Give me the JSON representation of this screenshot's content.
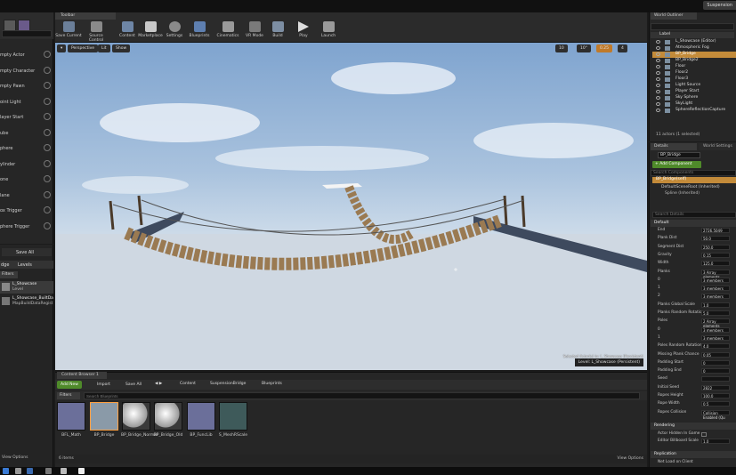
{
  "window": {
    "title": "Suspension"
  },
  "modes": {
    "items": [
      {
        "label": "mpty Actor"
      },
      {
        "label": "mpty Character"
      },
      {
        "label": "mpty Pawn"
      },
      {
        "label": "oint Light"
      },
      {
        "label": "layer Start"
      },
      {
        "label": "ube"
      },
      {
        "label": "phere"
      },
      {
        "label": "ylinder"
      },
      {
        "label": "one"
      },
      {
        "label": "lane"
      },
      {
        "label": "ox Trigger"
      },
      {
        "label": "phere Trigger"
      }
    ]
  },
  "left_panel": {
    "save_all": "Save All",
    "tabs": [
      "dge",
      "Levels"
    ],
    "filters": "Filters",
    "levels": [
      {
        "name": "L_Showcase",
        "sub": "Level"
      },
      {
        "name": "L_Showcase_BuiltDa",
        "sub": "MapBuildDataRegist"
      }
    ]
  },
  "toolbar": {
    "tab": "Toolbar",
    "buttons": [
      {
        "label": "Save Current"
      },
      {
        "label": "Source Control"
      },
      {
        "label": "Content"
      },
      {
        "label": "Marketplace"
      },
      {
        "label": "Settings"
      },
      {
        "label": "Blueprints"
      },
      {
        "label": "Cinematics"
      },
      {
        "label": "VR Mode"
      },
      {
        "label": "Build"
      },
      {
        "label": "Play"
      },
      {
        "label": "Launch"
      }
    ]
  },
  "viewport": {
    "perspective": "Perspective",
    "lit": "Lit",
    "show": "Show",
    "grid_snap": "10",
    "rot_snap": "10°",
    "scale_snap": "0.25",
    "cam_speed": "4",
    "selected_label": "Selected Actor(s) in: L_Showcase (Persistent)",
    "level_label": "Level: L_Showcase (Persistent)"
  },
  "content_browser": {
    "tab": "Content Browser 1",
    "add_new": "Add New",
    "import": "Import",
    "save_all": "Save All",
    "breadcrumb": [
      "Content",
      "SuspensionBridge",
      "Blueprints"
    ],
    "filters": "Filters",
    "search_placeholder": "Search Blueprints",
    "assets": [
      {
        "name": "BFL_Math"
      },
      {
        "name": "BP_Bridge"
      },
      {
        "name": "BP_Bridge_Normal"
      },
      {
        "name": "BP_Bridge_Old"
      },
      {
        "name": "BP_FuncLib"
      },
      {
        "name": "S_MeshRScale"
      }
    ],
    "item_count": "6 items",
    "view_options": "View Options"
  },
  "left_status": {
    "view_options": "View Options"
  },
  "outliner": {
    "tab": "World Outliner",
    "column": "Label",
    "items": [
      {
        "label": "L_Showcase (Editor)"
      },
      {
        "label": "Atmospheric Fog"
      },
      {
        "label": "BP_Bridge"
      },
      {
        "label": "BP_Bridge2"
      },
      {
        "label": "Floor"
      },
      {
        "label": "Floor2"
      },
      {
        "label": "Floor3"
      },
      {
        "label": "Light Source"
      },
      {
        "label": "Player Start"
      },
      {
        "label": "Sky Sphere"
      },
      {
        "label": "SkyLight"
      },
      {
        "label": "SphereReflectionCapture"
      }
    ],
    "status": "11 actors (1 selected)"
  },
  "details": {
    "tab": "Details",
    "tab2": "World Settings",
    "name": "BP_Bridge",
    "add_component": "+ Add Component",
    "search_components": "Search Components",
    "self": "BP_Bridge(self)",
    "components": [
      "DefaultSceneRoot (Inherited)",
      "Spline (Inherited)"
    ],
    "search_details": "Search Details",
    "section_default": "Default",
    "rows": [
      {
        "label": "End",
        "value": "2726.5049"
      },
      {
        "label": "Plank Dist",
        "value": "50.0"
      },
      {
        "label": "Segment Dist",
        "value": "250.0"
      },
      {
        "label": "Gravity",
        "value": "0.15"
      },
      {
        "label": "Width",
        "value": "125.0"
      },
      {
        "label": "Planks",
        "value": "3 Array elements"
      },
      {
        "label": "0",
        "value": "3 members"
      },
      {
        "label": "1",
        "value": "3 members"
      },
      {
        "label": "2",
        "value": "3 members"
      },
      {
        "label": "Planks Global Scale",
        "value": "1.0"
      },
      {
        "label": "Planks Random Rotation",
        "value": "5.0"
      },
      {
        "label": "Poles",
        "value": "2 Array elements"
      },
      {
        "label": "0",
        "value": "3 members"
      },
      {
        "label": "1",
        "value": "3 members"
      },
      {
        "label": "Poles Random Rotation",
        "value": "4.0"
      },
      {
        "label": "Missing Plank Chance",
        "value": "0.05"
      },
      {
        "label": "Padding Start",
        "value": "0"
      },
      {
        "label": "Padding End",
        "value": "0"
      },
      {
        "label": "Seed",
        "value": ""
      },
      {
        "label": "Initial Seed",
        "value": "2822"
      },
      {
        "label": "Ropes Height",
        "value": "100.0"
      },
      {
        "label": "Rope Width",
        "value": "0.5"
      },
      {
        "label": "Ropes Collision",
        "value": "Collision Enabled (Qu"
      }
    ],
    "section_rendering": "Rendering",
    "rendering_rows": [
      {
        "label": "Actor Hidden In Game",
        "value": ""
      },
      {
        "label": "Editor Billboard Scale",
        "value": "1.0"
      }
    ],
    "section_replication": "Replication",
    "replication_rows": [
      {
        "label": "Net Load on Client",
        "value": ""
      }
    ]
  }
}
